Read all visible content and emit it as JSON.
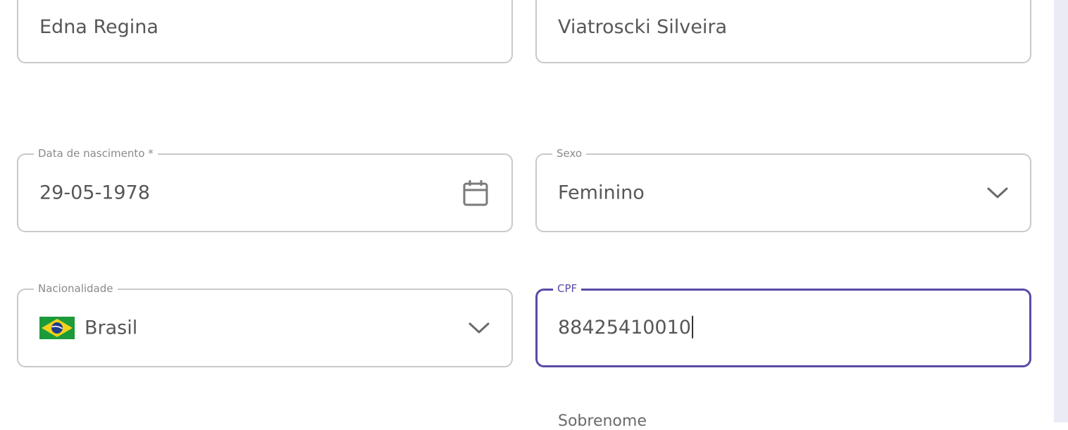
{
  "fields": {
    "first_name": {
      "value": "Edna Regina"
    },
    "last_name": {
      "value": "Viatroscki Silveira"
    },
    "birth_date": {
      "label": "Data de nascimento *",
      "value": "29-05-1978",
      "icon": "calendar-icon"
    },
    "sex": {
      "label": "Sexo",
      "value": "Feminino",
      "icon": "chevron-down-icon"
    },
    "nationality": {
      "label": "Nacionalidade",
      "value": "Brasil",
      "flag": "brazil-flag-icon",
      "icon": "chevron-down-icon"
    },
    "cpf": {
      "label": "CPF",
      "value": "88425410010"
    }
  },
  "next_field": {
    "label": "Sobrenome"
  },
  "colors": {
    "accent": "#5b4aa6",
    "border": "#c9c9c9",
    "label": "#8a8a8a",
    "scrollbar": "#ebebf6"
  }
}
